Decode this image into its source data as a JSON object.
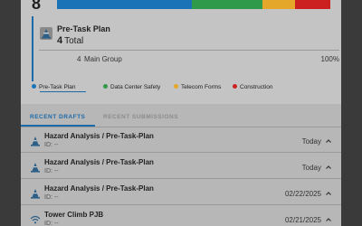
{
  "summary": {
    "total_big": "8",
    "bar_segments": [
      {
        "color": "#1a73b7",
        "share": 0.46
      },
      {
        "color": "#2f9a4a",
        "share": 0.24
      },
      {
        "color": "#e4a72a",
        "share": 0.11
      },
      {
        "color": "#cc1f1f",
        "share": 0.12
      }
    ]
  },
  "plan": {
    "title": "Pre-Task Plan",
    "count": "4",
    "count_label": "Total",
    "group_count": "4",
    "group_label": "Main Group",
    "group_pct": "100%"
  },
  "legend": [
    {
      "label": "Pre-Task Plan",
      "color": "#1a73b7"
    },
    {
      "label": "Data Center Safety",
      "color": "#2f9a4a"
    },
    {
      "label": "Telecom Forms",
      "color": "#e4a72a"
    },
    {
      "label": "Construction",
      "color": "#cc1f1f"
    }
  ],
  "tabs": {
    "active": "RECENT DRAFTS",
    "inactive": "RECENT SUBMISSIONS"
  },
  "rows": [
    {
      "title": "Hazard Analysis / Pre-Task-Plan",
      "id": "ID: --",
      "date": "Today",
      "icon": "cone-icon"
    },
    {
      "title": "Hazard Analysis / Pre-Task-Plan",
      "id": "ID: --",
      "date": "Today",
      "icon": "cone-icon"
    },
    {
      "title": "Hazard Analysis / Pre-Task-Plan",
      "id": "ID: --",
      "date": "02/22/2025",
      "icon": "cone-icon"
    },
    {
      "title": "Tower Climb PJB",
      "id": "ID: --",
      "date": "02/21/2025",
      "icon": "wifi-icon"
    }
  ]
}
